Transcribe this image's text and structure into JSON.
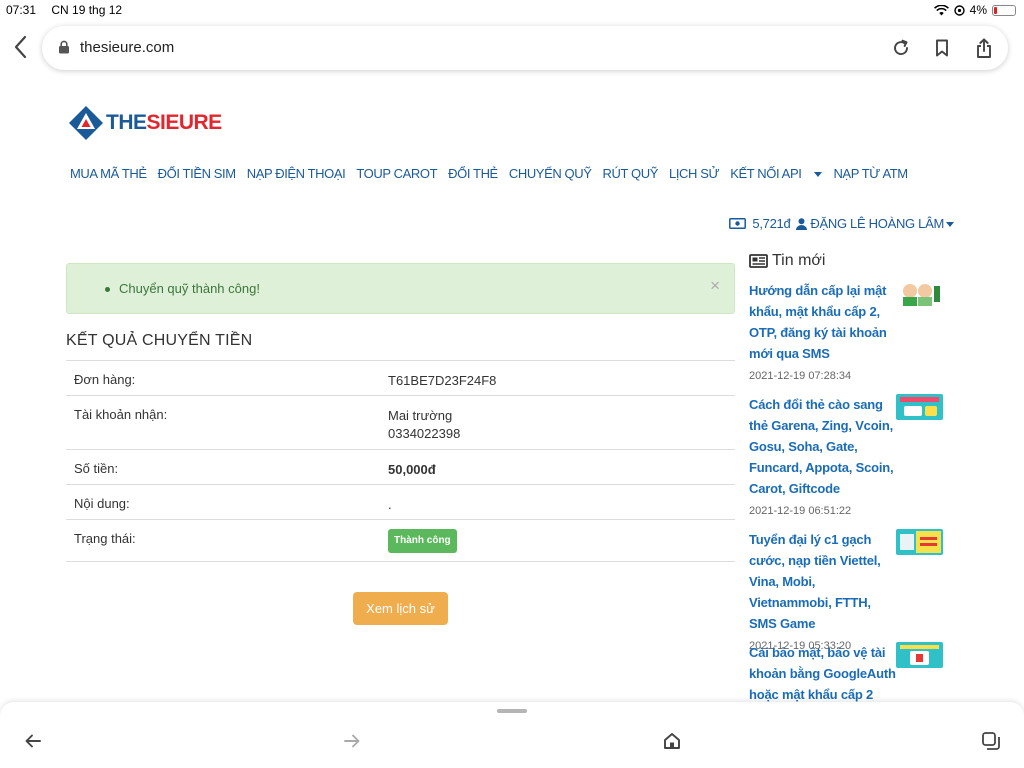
{
  "status_bar": {
    "time": "07:31",
    "date": "CN 19 thg 12",
    "battery": "4%"
  },
  "browser": {
    "url": "thesieure.com"
  },
  "site": {
    "logo_part1": "THE",
    "logo_part2": "SIEURE",
    "nav": [
      {
        "label": "MUA MÃ THẺ"
      },
      {
        "label": "ĐỔI TIỀN SIM"
      },
      {
        "label": "NẠP ĐIỆN THOẠI"
      },
      {
        "label": "TOUP CAROT"
      },
      {
        "label": "ĐỔI THẺ"
      },
      {
        "label": "CHUYỂN QUỸ"
      },
      {
        "label": "RÚT QUỸ"
      },
      {
        "label": "LỊCH SỬ"
      },
      {
        "label": "KẾT NỐI API"
      },
      {
        "label": "NẠP TỪ ATM"
      }
    ],
    "user": {
      "balance": "5,721đ",
      "name": "ĐẶNG LÊ HOÀNG LÂM"
    }
  },
  "main": {
    "alert": {
      "message": "Chuyển quỹ thành công!",
      "close": "×"
    },
    "section_title": "KẾT QUẢ CHUYỂN TIỀN",
    "rows": {
      "order": {
        "label": "Đơn hàng:",
        "value": "T61BE7D23F24F8"
      },
      "receiver": {
        "label": "Tài khoản nhận:",
        "name": "Mai trường",
        "phone": "0334022398"
      },
      "amount": {
        "label": "Số tiền:",
        "value": "50,000đ"
      },
      "content": {
        "label": "Nội dung:",
        "value": "."
      },
      "status": {
        "label": "Trạng thái:",
        "value": "Thành công"
      }
    },
    "history_button": "Xem lịch sử"
  },
  "sidebar": {
    "title": "Tin mới",
    "news": [
      {
        "title": "Hướng dẫn cấp lại mật khẩu, mật khẩu cấp 2, OTP, đăng ký tài khoản mới qua SMS",
        "date": "2021-12-19 07:28:34"
      },
      {
        "title": "Cách đổi thẻ cào sang thẻ Garena, Zing, Vcoin, Gosu, Soha, Gate, Funcard, Appota, Scoin, Carot, Giftcode",
        "date": "2021-12-19 06:51:22"
      },
      {
        "title": "Tuyển đại lý c1 gạch cước, nạp tiền Viettel, Vina, Mobi, Vietnammobi, FTTH, SMS Game",
        "date": "2021-12-19 05:33:20"
      },
      {
        "title": "Cài bảo mật, bảo vệ tài khoản bằng GoogleAuth hoặc mật khẩu cấp 2",
        "date": ""
      }
    ]
  },
  "colors": {
    "link": "#1b6cb6",
    "nav": "#1b5a99",
    "success_bg": "#dff0d8",
    "success_text": "#3c763d",
    "badge": "#5cb85c",
    "button": "#f0ad4e"
  }
}
